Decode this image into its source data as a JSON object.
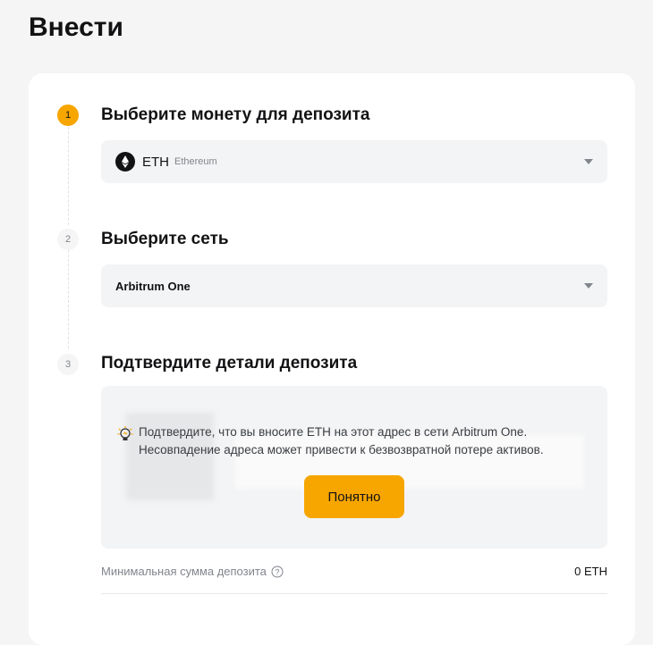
{
  "page": {
    "title": "Внести"
  },
  "steps": [
    {
      "number": "1",
      "title": "Выберите монету для депозита",
      "coin": {
        "symbol": "ETH",
        "name": "Ethereum",
        "icon": "ethereum-icon"
      }
    },
    {
      "number": "2",
      "title": "Выберите сеть",
      "network": "Arbitrum One"
    },
    {
      "number": "3",
      "title": "Подтвердите детали депозита",
      "warning": {
        "line1": "Подтвердите, что вы вносите ETH на этот адрес в сети Arbitrum One.",
        "line2": "Несовпадение адреса может привести к безвозвратной потере активов.",
        "icon": "lightbulb-icon"
      },
      "confirm_label": "Понятно",
      "min_deposit": {
        "label": "Минимальная сумма депозита",
        "value": "0 ETH"
      }
    }
  ],
  "colors": {
    "accent": "#f7a600",
    "background": "#f5f5f5",
    "field": "#f3f4f5"
  }
}
